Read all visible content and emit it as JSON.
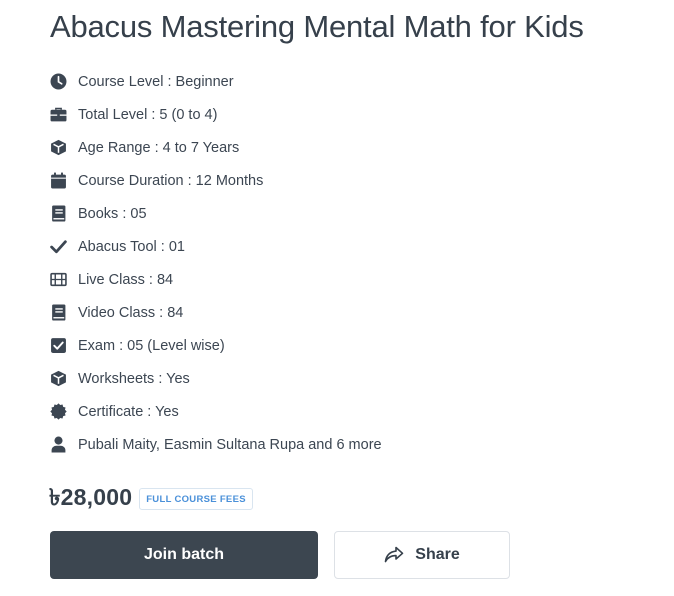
{
  "course": {
    "title": "Abacus Mastering Mental Math for Kids"
  },
  "features": [
    {
      "icon": "clock-icon",
      "label": "Course Level : Beginner"
    },
    {
      "icon": "briefcase-icon",
      "label": "Total Level : 5 (0 to 4)"
    },
    {
      "icon": "cube-icon",
      "label": "Age Range : 4 to 7 Years"
    },
    {
      "icon": "calendar-icon",
      "label": "Course Duration : 12 Months"
    },
    {
      "icon": "book-icon",
      "label": "Books : 05"
    },
    {
      "icon": "check-icon",
      "label": "Abacus Tool : 01"
    },
    {
      "icon": "film-icon",
      "label": "Live Class : 84"
    },
    {
      "icon": "book-icon",
      "label": "Video Class : 84"
    },
    {
      "icon": "checkbox-icon",
      "label": "Exam : 05 (Level wise)"
    },
    {
      "icon": "cube-icon",
      "label": "Worksheets : Yes"
    },
    {
      "icon": "certificate-icon",
      "label": "Certificate : Yes"
    },
    {
      "icon": "user-icon",
      "label": "Pubali Maity, Easmin Sultana Rupa and 6 more"
    }
  ],
  "pricing": {
    "price": "৳28,000",
    "badge": "FULL COURSE FEES"
  },
  "actions": {
    "join_label": "Join batch",
    "share_label": "Share"
  },
  "colors": {
    "text": "#36404b",
    "icon": "#3c4652",
    "primary_button": "#3c4650",
    "badge_text": "#4a90d9"
  }
}
